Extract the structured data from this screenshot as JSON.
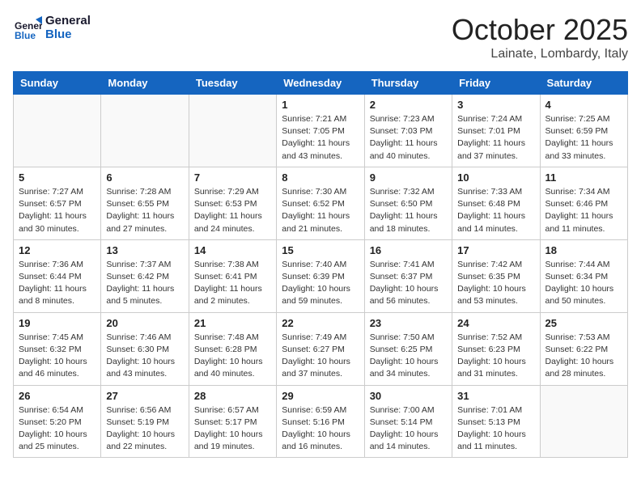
{
  "header": {
    "logo_text_general": "General",
    "logo_text_blue": "Blue",
    "month": "October 2025",
    "location": "Lainate, Lombardy, Italy"
  },
  "weekdays": [
    "Sunday",
    "Monday",
    "Tuesday",
    "Wednesday",
    "Thursday",
    "Friday",
    "Saturday"
  ],
  "weeks": [
    [
      {
        "day": "",
        "info": ""
      },
      {
        "day": "",
        "info": ""
      },
      {
        "day": "",
        "info": ""
      },
      {
        "day": "1",
        "info": "Sunrise: 7:21 AM\nSunset: 7:05 PM\nDaylight: 11 hours and 43 minutes."
      },
      {
        "day": "2",
        "info": "Sunrise: 7:23 AM\nSunset: 7:03 PM\nDaylight: 11 hours and 40 minutes."
      },
      {
        "day": "3",
        "info": "Sunrise: 7:24 AM\nSunset: 7:01 PM\nDaylight: 11 hours and 37 minutes."
      },
      {
        "day": "4",
        "info": "Sunrise: 7:25 AM\nSunset: 6:59 PM\nDaylight: 11 hours and 33 minutes."
      }
    ],
    [
      {
        "day": "5",
        "info": "Sunrise: 7:27 AM\nSunset: 6:57 PM\nDaylight: 11 hours and 30 minutes."
      },
      {
        "day": "6",
        "info": "Sunrise: 7:28 AM\nSunset: 6:55 PM\nDaylight: 11 hours and 27 minutes."
      },
      {
        "day": "7",
        "info": "Sunrise: 7:29 AM\nSunset: 6:53 PM\nDaylight: 11 hours and 24 minutes."
      },
      {
        "day": "8",
        "info": "Sunrise: 7:30 AM\nSunset: 6:52 PM\nDaylight: 11 hours and 21 minutes."
      },
      {
        "day": "9",
        "info": "Sunrise: 7:32 AM\nSunset: 6:50 PM\nDaylight: 11 hours and 18 minutes."
      },
      {
        "day": "10",
        "info": "Sunrise: 7:33 AM\nSunset: 6:48 PM\nDaylight: 11 hours and 14 minutes."
      },
      {
        "day": "11",
        "info": "Sunrise: 7:34 AM\nSunset: 6:46 PM\nDaylight: 11 hours and 11 minutes."
      }
    ],
    [
      {
        "day": "12",
        "info": "Sunrise: 7:36 AM\nSunset: 6:44 PM\nDaylight: 11 hours and 8 minutes."
      },
      {
        "day": "13",
        "info": "Sunrise: 7:37 AM\nSunset: 6:42 PM\nDaylight: 11 hours and 5 minutes."
      },
      {
        "day": "14",
        "info": "Sunrise: 7:38 AM\nSunset: 6:41 PM\nDaylight: 11 hours and 2 minutes."
      },
      {
        "day": "15",
        "info": "Sunrise: 7:40 AM\nSunset: 6:39 PM\nDaylight: 10 hours and 59 minutes."
      },
      {
        "day": "16",
        "info": "Sunrise: 7:41 AM\nSunset: 6:37 PM\nDaylight: 10 hours and 56 minutes."
      },
      {
        "day": "17",
        "info": "Sunrise: 7:42 AM\nSunset: 6:35 PM\nDaylight: 10 hours and 53 minutes."
      },
      {
        "day": "18",
        "info": "Sunrise: 7:44 AM\nSunset: 6:34 PM\nDaylight: 10 hours and 50 minutes."
      }
    ],
    [
      {
        "day": "19",
        "info": "Sunrise: 7:45 AM\nSunset: 6:32 PM\nDaylight: 10 hours and 46 minutes."
      },
      {
        "day": "20",
        "info": "Sunrise: 7:46 AM\nSunset: 6:30 PM\nDaylight: 10 hours and 43 minutes."
      },
      {
        "day": "21",
        "info": "Sunrise: 7:48 AM\nSunset: 6:28 PM\nDaylight: 10 hours and 40 minutes."
      },
      {
        "day": "22",
        "info": "Sunrise: 7:49 AM\nSunset: 6:27 PM\nDaylight: 10 hours and 37 minutes."
      },
      {
        "day": "23",
        "info": "Sunrise: 7:50 AM\nSunset: 6:25 PM\nDaylight: 10 hours and 34 minutes."
      },
      {
        "day": "24",
        "info": "Sunrise: 7:52 AM\nSunset: 6:23 PM\nDaylight: 10 hours and 31 minutes."
      },
      {
        "day": "25",
        "info": "Sunrise: 7:53 AM\nSunset: 6:22 PM\nDaylight: 10 hours and 28 minutes."
      }
    ],
    [
      {
        "day": "26",
        "info": "Sunrise: 6:54 AM\nSunset: 5:20 PM\nDaylight: 10 hours and 25 minutes."
      },
      {
        "day": "27",
        "info": "Sunrise: 6:56 AM\nSunset: 5:19 PM\nDaylight: 10 hours and 22 minutes."
      },
      {
        "day": "28",
        "info": "Sunrise: 6:57 AM\nSunset: 5:17 PM\nDaylight: 10 hours and 19 minutes."
      },
      {
        "day": "29",
        "info": "Sunrise: 6:59 AM\nSunset: 5:16 PM\nDaylight: 10 hours and 16 minutes."
      },
      {
        "day": "30",
        "info": "Sunrise: 7:00 AM\nSunset: 5:14 PM\nDaylight: 10 hours and 14 minutes."
      },
      {
        "day": "31",
        "info": "Sunrise: 7:01 AM\nSunset: 5:13 PM\nDaylight: 10 hours and 11 minutes."
      },
      {
        "day": "",
        "info": ""
      }
    ]
  ]
}
